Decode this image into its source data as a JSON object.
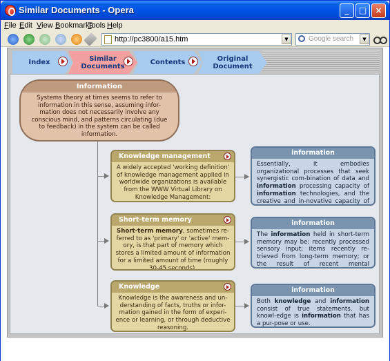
{
  "window": {
    "title": "Similar Documents - Opera"
  },
  "menubar": {
    "items": [
      "File",
      "Edit",
      "View",
      "Bookmarks",
      "Tools",
      "Help"
    ]
  },
  "navbar": {
    "address": "http://pc3800/a15.htm",
    "search_placeholder": "Google search",
    "icons": [
      "rewind-icon",
      "back-icon",
      "forward-icon",
      "fast-forward-icon",
      "reload-icon",
      "edit-icon",
      "page-icon",
      "search-engine-icon",
      "glasses-icon"
    ]
  },
  "tabs": [
    {
      "label": "Index",
      "color": "#a8cbf0"
    },
    {
      "label": "Similar Documents",
      "color": "#f3a0a0"
    },
    {
      "label": "Contents",
      "color": "#a8cbf0"
    },
    {
      "label": "Original Document",
      "color": "#a8cbf0"
    }
  ],
  "root": {
    "title": "Information",
    "text": "Systems theory at times seems to refer to information in this sense, assuming infor-mation does not necessarily involve any conscious mind, and patterns circulating (due to feedback) in the system can be called information."
  },
  "rows": [
    {
      "concept": {
        "title": "Knowledge management",
        "text": "A widely accepted 'working definition' of knowledge management applied in worldwide organizations is available from the WWW Virtual Library on Knowledge Management:"
      },
      "info": {
        "title": "information",
        "text": "Essentially, it embodies organizational processes that seek synergistic com-bination of data and information processing capacity of information technologies, and the creative and in-novative capacity of human beings.'"
      }
    },
    {
      "concept": {
        "title": "Short-term memory",
        "text": "Short-term memory, sometimes re-ferred to as 'primary' or 'active' mem-ory, is that part of memory which stores a limited amount of information for a limited amount of time (roughly 30-45 seconds)."
      },
      "info": {
        "title": "information",
        "text": "The information held in short-term memory may be: recently processed sensory input; items recently re-trieved from long-term memory; or the result of recent mental processing."
      }
    },
    {
      "concept": {
        "title": "Knowledge",
        "text": "Knowledge is the awareness and un-derstanding of facts, truths or infor-mation gained in the form of experi-ence or learning, or through deductive reasoning."
      },
      "info": {
        "title": "information",
        "text": "Both knowledge and information consist of true statements, but knowl-edge is information that has a pur-pose or use."
      }
    }
  ]
}
